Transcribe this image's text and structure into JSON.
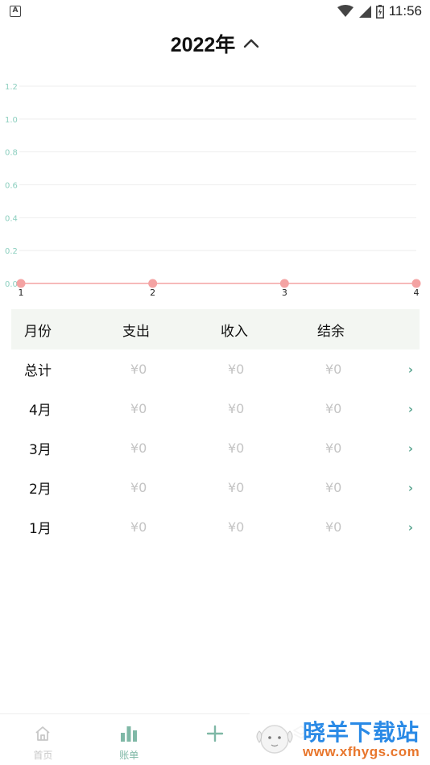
{
  "status_bar": {
    "time": "11:56",
    "left_icon_letter": "A",
    "icons": [
      "wifi-icon",
      "signal-icon",
      "battery-icon"
    ]
  },
  "header": {
    "year_title": "2022年",
    "toggle_icon": "chevron-up-icon"
  },
  "chart_data": {
    "type": "line",
    "x": [
      1,
      2,
      3,
      4
    ],
    "values": [
      0,
      0,
      0,
      0
    ],
    "xtick_labels": [
      "1",
      "2",
      "3",
      "4"
    ],
    "ytick_labels": [
      "0.0",
      "0.2",
      "0.4",
      "0.6",
      "0.8",
      "1.0",
      "1.2"
    ],
    "ylim": [
      0,
      1.2
    ],
    "grid": true,
    "title": "",
    "xlabel": "",
    "ylabel": "",
    "colors": {
      "line": "#f4a3a3",
      "point": "#f4a3a3",
      "grid": "#eeeeee",
      "ytick": "#8ccfbf",
      "xtick": "#222222"
    }
  },
  "table": {
    "headers": [
      "月份",
      "支出",
      "收入",
      "结余"
    ],
    "rows": [
      {
        "month": "总计",
        "expense": "¥0",
        "income": "¥0",
        "balance": "¥0"
      },
      {
        "month": "4月",
        "expense": "¥0",
        "income": "¥0",
        "balance": "¥0"
      },
      {
        "month": "3月",
        "expense": "¥0",
        "income": "¥0",
        "balance": "¥0"
      },
      {
        "month": "2月",
        "expense": "¥0",
        "income": "¥0",
        "balance": "¥0"
      },
      {
        "month": "1月",
        "expense": "¥0",
        "income": "¥0",
        "balance": "¥0"
      }
    ],
    "row_arrow": "›"
  },
  "bottom_nav": {
    "items": [
      {
        "label": "首页",
        "icon": "home-icon",
        "active": false
      },
      {
        "label": "账单",
        "icon": "bar-chart-icon",
        "active": true
      },
      {
        "label": "",
        "icon": "plus-icon",
        "active": false
      },
      {
        "label": "",
        "icon": "layers-icon",
        "active": false
      },
      {
        "label": "",
        "icon": "user-icon",
        "active": false
      }
    ],
    "active_color": "#7fb8a6",
    "inactive_color": "#c8c8c8"
  },
  "watermark": {
    "title": "晓羊下载站",
    "url": "www.xfhygs.com"
  }
}
